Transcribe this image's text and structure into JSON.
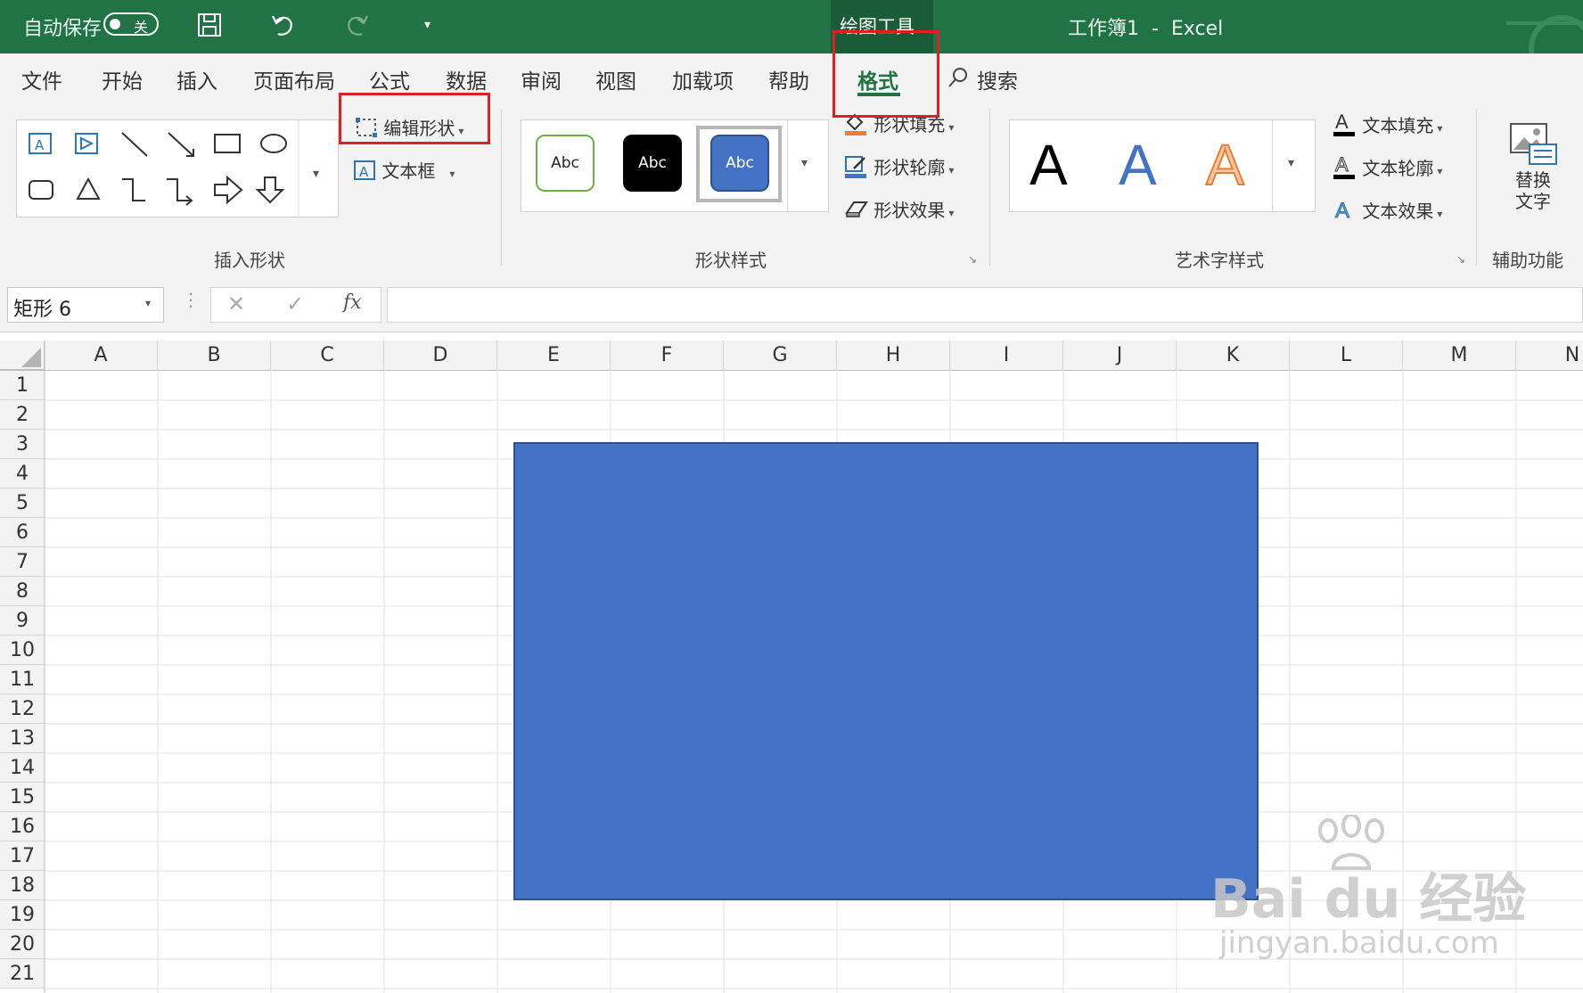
{
  "titlebar": {
    "autosave_label": "自动保存",
    "autosave_state": "关",
    "context_tab": "绘图工具",
    "window_title": "工作簿1  -  Excel"
  },
  "ribbon_tabs": [
    "文件",
    "开始",
    "插入",
    "页面布局",
    "公式",
    "数据",
    "审阅",
    "视图",
    "加载项",
    "帮助",
    "格式"
  ],
  "search_label": "搜索",
  "groups": {
    "insert_shapes": {
      "label": "插入形状",
      "edit_shape": "编辑形状",
      "text_box": "文本框"
    },
    "shape_styles": {
      "label": "形状样式",
      "presets": [
        "Abc",
        "Abc",
        "Abc"
      ],
      "fill": "形状填充",
      "outline": "形状轮廓",
      "effects": "形状效果"
    },
    "wordart": {
      "label": "艺术字样式",
      "letters": [
        "A",
        "A",
        "A"
      ],
      "text_fill": "文本填充",
      "text_outline": "文本轮廓",
      "text_effects": "文本效果"
    },
    "accessibility": {
      "label": "辅助功能",
      "alt_text_line1": "替换",
      "alt_text_line2": "文字"
    }
  },
  "name_box": "矩形 6",
  "formula_fx": "fx",
  "columns": [
    "A",
    "B",
    "C",
    "D",
    "E",
    "F",
    "G",
    "H",
    "I",
    "J",
    "K",
    "L",
    "M",
    "N"
  ],
  "rows": [
    "1",
    "2",
    "3",
    "4",
    "5",
    "6",
    "7",
    "8",
    "9",
    "10",
    "11",
    "12",
    "13",
    "14",
    "15",
    "16",
    "17",
    "18",
    "19",
    "20",
    "21"
  ],
  "shape_color": "#4472c4",
  "accent_color": "#217346",
  "watermark": {
    "brand": "Bai du 经验",
    "url": "jingyan.baidu.com"
  }
}
